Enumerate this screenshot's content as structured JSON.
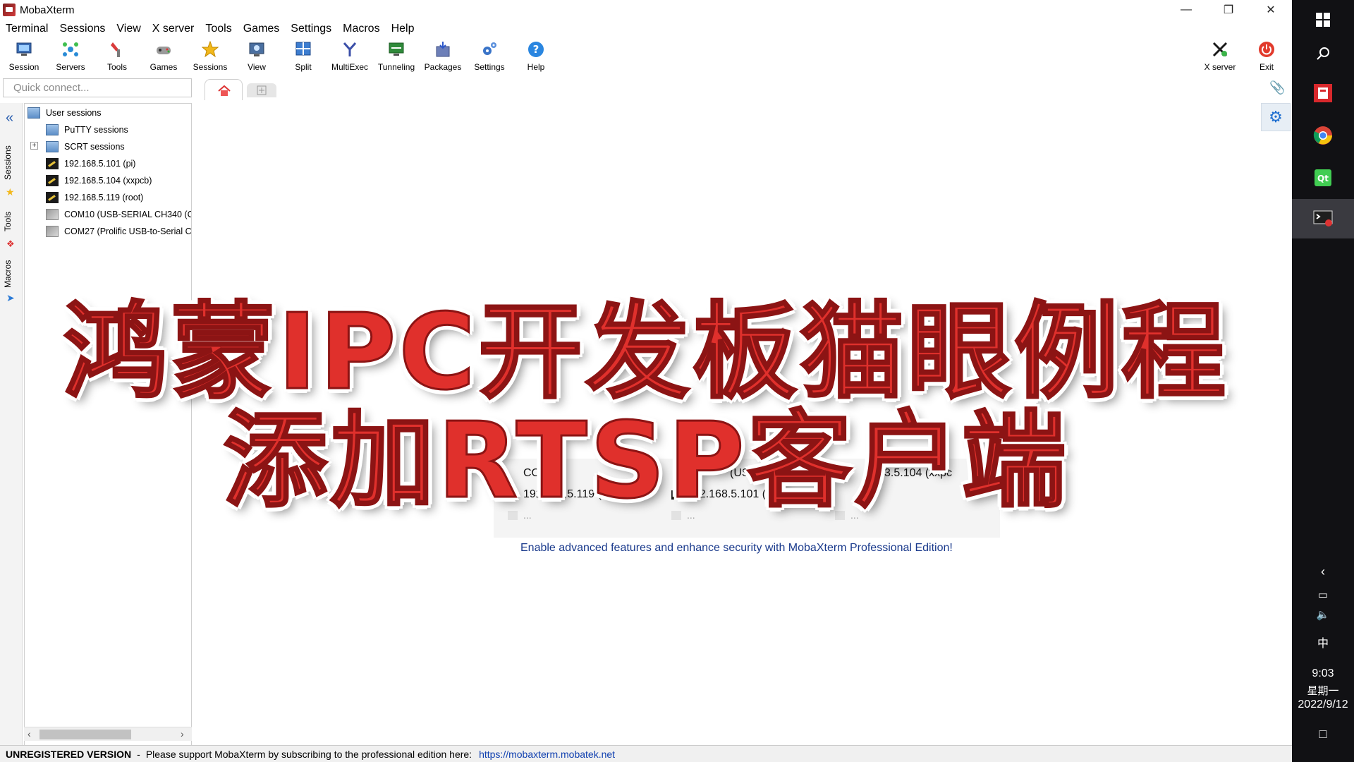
{
  "window": {
    "title": "MobaXterm"
  },
  "menu": [
    "Terminal",
    "Sessions",
    "View",
    "X server",
    "Tools",
    "Games",
    "Settings",
    "Macros",
    "Help"
  ],
  "toolbar": {
    "session": "Session",
    "servers": "Servers",
    "tools": "Tools",
    "games": "Games",
    "sessions": "Sessions",
    "view": "View",
    "split": "Split",
    "multiexec": "MultiExec",
    "tunneling": "Tunneling",
    "packages": "Packages",
    "settings": "Settings",
    "help": "Help",
    "xserver": "X server",
    "exit": "Exit"
  },
  "quick_connect": {
    "placeholder": "Quick connect..."
  },
  "sidebar": {
    "tabs": {
      "sessions": "Sessions",
      "tools": "Tools",
      "macros": "Macros"
    },
    "tree": [
      "User sessions",
      "PuTTY sessions",
      "SCRT sessions",
      "192.168.5.101 (pi)",
      "192.168.5.104 (xxpcb)",
      "192.168.5.119 (root)",
      "COM10  (USB-SERIAL CH340 (C",
      "COM27  (Prolific USB-to-Serial C"
    ]
  },
  "recent": {
    "row1": [
      "COM",
      "(USB-SI",
      "3.5.104 (xxpc"
    ],
    "row2": [
      "192.168.5.119 (root)",
      "192.168.5.101 (pi)"
    ],
    "more": "..."
  },
  "promo": "Enable advanced features and enhance security with MobaXterm Professional Edition!",
  "overlay": {
    "line1": "鸿蒙IPC开发板猫眼例程",
    "line2": "添加RTSP客户端"
  },
  "statusbar": {
    "unregistered": "UNREGISTERED VERSION",
    "separator": "-",
    "message": "Please support MobaXterm by subscribing to the professional edition here:",
    "link": "https://mobaxterm.mobatek.net"
  },
  "taskbar": {
    "time": "9:03",
    "weekday": "星期一",
    "date": "2022/9/12",
    "ime": "中"
  }
}
